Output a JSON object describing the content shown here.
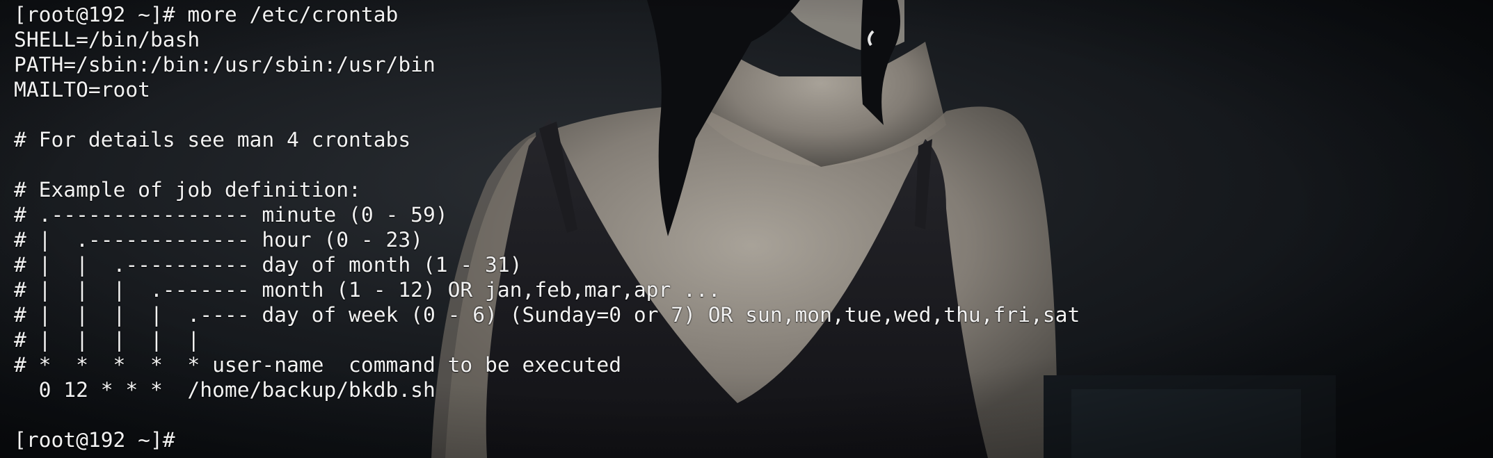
{
  "terminal": {
    "lines": [
      "[root@192 ~]# more /etc/crontab",
      "SHELL=/bin/bash",
      "PATH=/sbin:/bin:/usr/sbin:/usr/bin",
      "MAILTO=root",
      "",
      "# For details see man 4 crontabs",
      "",
      "# Example of job definition:",
      "# .---------------- minute (0 - 59)",
      "# |  .------------- hour (0 - 23)",
      "# |  |  .---------- day of month (1 - 31)",
      "# |  |  |  .------- month (1 - 12) OR jan,feb,mar,apr ...",
      "# |  |  |  |  .---- day of week (0 - 6) (Sunday=0 or 7) OR sun,mon,tue,wed,thu,fri,sat",
      "# |  |  |  |  |",
      "# *  *  *  *  * user-name  command to be executed",
      "  0 12 * * *  /home/backup/bkdb.sh",
      "",
      "[root@192 ~]#"
    ]
  },
  "colors": {
    "background": "#0d1014",
    "text": "#f2f2f2"
  }
}
